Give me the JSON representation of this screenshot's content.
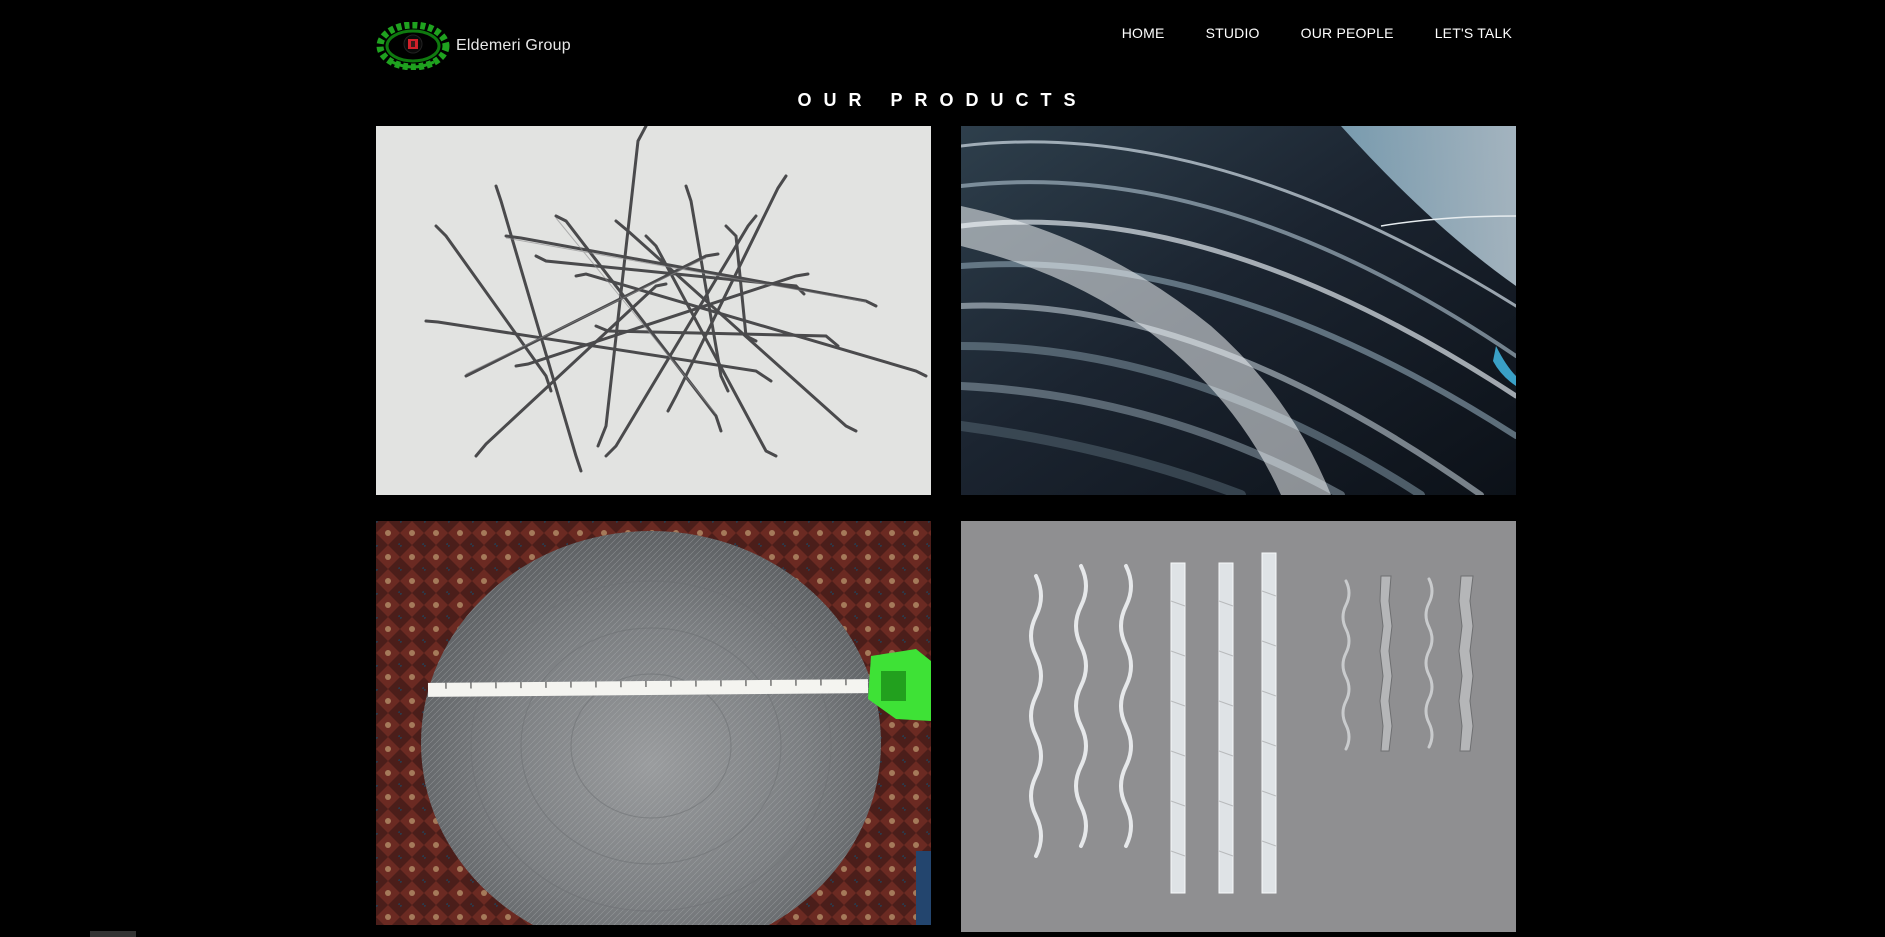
{
  "brand": {
    "name": "Eldemeri Group",
    "logo_icon": "laurel-wreath-logo-icon"
  },
  "nav": {
    "items": [
      "HOME",
      "STUDIO",
      "OUR PEOPLE",
      "LET'S TALK"
    ]
  },
  "page": {
    "title": "OUR PRODUCTS"
  },
  "products": [
    {
      "image": "steel-fiber-hooked-pile-image"
    },
    {
      "image": "steel-wire-coil-closeup-image"
    },
    {
      "image": "steel-wool-pad-with-tape-measure-image"
    },
    {
      "image": "corrugated-steel-fibers-image"
    }
  ],
  "colors": {
    "background": "#000000",
    "text": "#ffffff",
    "logo_green": "#1fa21f",
    "logo_red": "#d0202a"
  }
}
